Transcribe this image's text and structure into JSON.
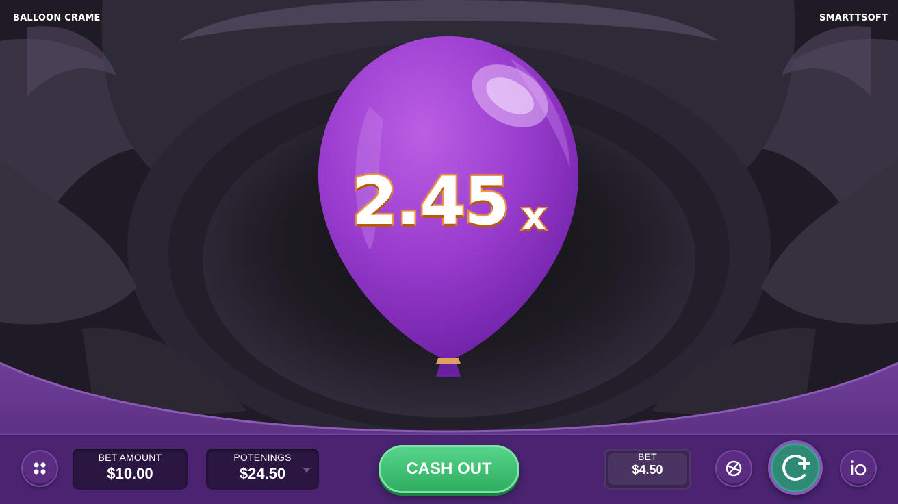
{
  "header": {
    "game_title": "BALLOON CRAME",
    "provider": "SMARTTSOFT"
  },
  "game": {
    "multiplier_value": "2.45",
    "multiplier_suffix": "x",
    "balloon_color": "#9b3fcf"
  },
  "controls": {
    "menu_icon": "grid-dots-icon",
    "bet_amount": {
      "label": "BET AMOUNT",
      "value": "$10.00"
    },
    "potential_winnings": {
      "label": "POTENINGS",
      "value": "$24.50"
    },
    "cash_out_label": "CASH OUT",
    "bet": {
      "label": "BET",
      "value": "$4.50"
    },
    "stats_icon": "chart-circle-icon",
    "auto_icon": "refresh-plus-icon",
    "info_icon": "info-io-icon"
  },
  "colors": {
    "accent_purple": "#5a2d82",
    "cash_out_green": "#3cbf72",
    "multiplier_outline": "#e8892e"
  }
}
